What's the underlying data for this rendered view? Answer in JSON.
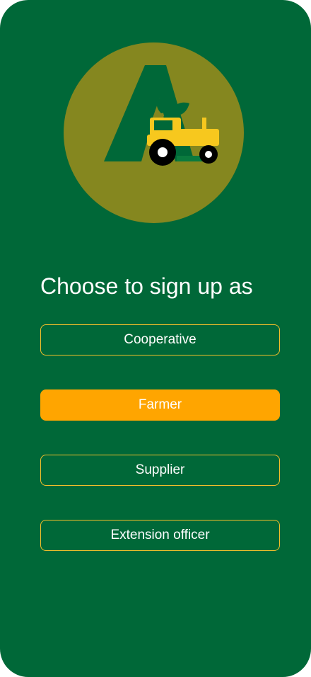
{
  "logo": {
    "icon": "tractor-logo-icon",
    "circle_color": "#85871f",
    "letter_color": "#006838",
    "tractor_color": "#f7c81e"
  },
  "heading": "Choose to sign up as",
  "options": [
    {
      "label": "Cooperative",
      "selected": false
    },
    {
      "label": "Farmer",
      "selected": true
    },
    {
      "label": "Supplier",
      "selected": false
    },
    {
      "label": "Extension officer",
      "selected": false
    }
  ],
  "colors": {
    "background": "#006838",
    "accent": "#ffa500",
    "outline": "#f2bf2a",
    "text": "#ffffff"
  }
}
